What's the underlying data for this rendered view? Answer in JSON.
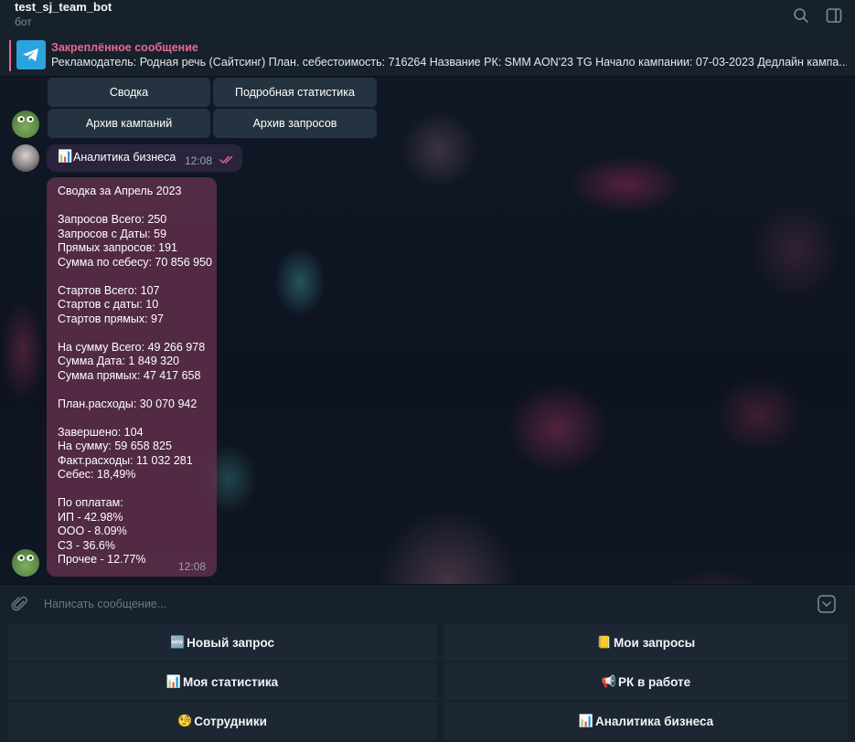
{
  "header": {
    "title": "test_sj_team_bot",
    "subtitle": "бот",
    "search_icon": "search-icon",
    "sidebar_icon": "sidebar-toggle-icon"
  },
  "pinned": {
    "title": "Закреплённое сообщение",
    "text": "Рекламодатель: Родная речь (Сайтсинг)  План. себестоимость: 716264  Название РК: SMM AON'23 TG  Начало кампании: 07-03-2023 Дедлайн кампа..."
  },
  "inline_keyboard": {
    "summary": "Сводка",
    "detailed": "Подробная статистика",
    "campaign_archive": "Архив кампаний",
    "request_archive": "Архив запросов"
  },
  "outgoing_message": {
    "emoji": "📊",
    "text": "Аналитика бизнеса",
    "time": "12:08",
    "status_icon": "double-check-icon"
  },
  "incoming_message": {
    "time": "12:08",
    "lines": [
      "Сводка за Апрель 2023",
      "",
      "Запросов Всего: 250",
      "Запросов с Даты: 59",
      "Прямых запросов: 191",
      "Сумма по себесу: 70 856 950",
      "",
      "Стартов Всего: 107",
      "Стартов с даты: 10",
      "Стартов прямых: 97",
      "",
      "На сумму Всего: 49 266 978",
      "Сумма Дата: 1 849 320",
      "Сумма прямых: 47 417 658",
      "",
      "План.расходы: 30 070 942",
      "",
      "Завершено: 104",
      "На сумму: 59 658 825",
      "Факт.расходы: 11 032 281",
      "Себес: 18,49%",
      "",
      "По оплатам:",
      "ИП - 42.98%",
      "ООО - 8.09%",
      "СЗ - 36.6%",
      "Прочее - 12.77%"
    ]
  },
  "input": {
    "placeholder": "Написать сообщение..."
  },
  "keyboard": {
    "new_request": {
      "emoji": "🆕",
      "label": "Новый запрос"
    },
    "my_requests": {
      "emoji": "📒",
      "label": "Мои запросы"
    },
    "my_stats": {
      "emoji": "📊",
      "label": "Моя статистика"
    },
    "rk_in_work": {
      "emoji": "📢",
      "label": "РК в работе"
    },
    "employees": {
      "emoji": "🧐",
      "label": "Сотрудники"
    },
    "business_analytics": {
      "emoji": "📊",
      "label": "Аналитика бизнеса"
    }
  },
  "colors": {
    "accent_pink": "#e56a8e",
    "telegram_blue": "#2aa3df",
    "check_color": "#e36b8b"
  }
}
